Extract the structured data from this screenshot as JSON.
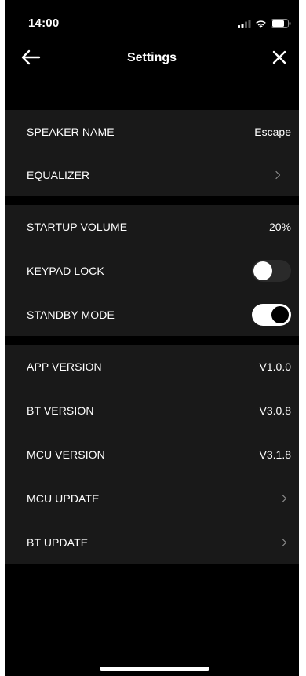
{
  "status_bar": {
    "time": "14:00",
    "icons": [
      "cellular-signal-icon",
      "wifi-icon",
      "battery-icon"
    ]
  },
  "nav": {
    "title": "Settings",
    "back_icon": "arrow-left-icon",
    "close_icon": "close-icon"
  },
  "groups": {
    "device": {
      "speaker_name": {
        "label": "SPEAKER NAME",
        "value": "Escape"
      },
      "equalizer": {
        "label": "EQUALIZER",
        "chevron": "chevron-right-icon"
      }
    },
    "controls": {
      "startup_volume": {
        "label": "STARTUP VOLUME",
        "value": "20%"
      },
      "keypad_lock": {
        "label": "KEYPAD LOCK",
        "on": false
      },
      "standby_mode": {
        "label": "STANDBY MODE",
        "on": true
      }
    },
    "info": {
      "app_version": {
        "label": "APP VERSION",
        "value": "V1.0.0"
      },
      "bt_version": {
        "label": "BT VERSION",
        "value": "V3.0.8"
      },
      "mcu_version": {
        "label": "MCU VERSION",
        "value": "V3.1.8"
      },
      "mcu_update": {
        "label": "MCU UPDATE",
        "chevron": "chevron-right-icon"
      },
      "bt_update": {
        "label": "BT UPDATE",
        "chevron": "chevron-right-icon"
      }
    }
  },
  "colors": {
    "background": "#000000",
    "group_background": "#191919",
    "text": "#ffffff",
    "chevron": "#8e8e8e",
    "toggle_off_track": "#2a2a2a"
  }
}
